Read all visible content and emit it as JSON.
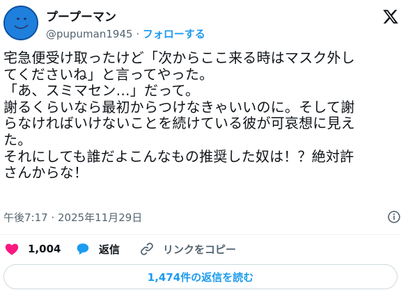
{
  "author": {
    "name": "プープーマン",
    "handle": "@pupuman1945",
    "separator": " · ",
    "follow_label": "フォローする"
  },
  "post": {
    "text": "宅急便受け取ったけど「次からここ来る時はマスク外し\nてくださいね」と言ってやった。\n「あ、スミマセン…」だって。\n謝るくらいなら最初からつけなきゃいいのに。そして謝\nらなければいけないことを続けている彼が可哀想に見え\nた。\nそれにしても誰だよこんなもの推奨した奴は！？絶対許\nさんからな！",
    "time": "午後7:17",
    "date_separator": " · ",
    "date": "2025年11月29日"
  },
  "actions": {
    "likes": "1,004",
    "reply_label": "返信",
    "copy_link_label": "リンクをコピー"
  },
  "read_replies_label": "1,474件の返信を読む",
  "colors": {
    "accent": "#1d9bf0",
    "like": "#f91880",
    "secondary_text": "#536471"
  },
  "icons": [
    "avatar-smiley-icon",
    "x-logo-icon",
    "info-icon",
    "heart-icon",
    "reply-bubble-icon",
    "link-icon"
  ]
}
